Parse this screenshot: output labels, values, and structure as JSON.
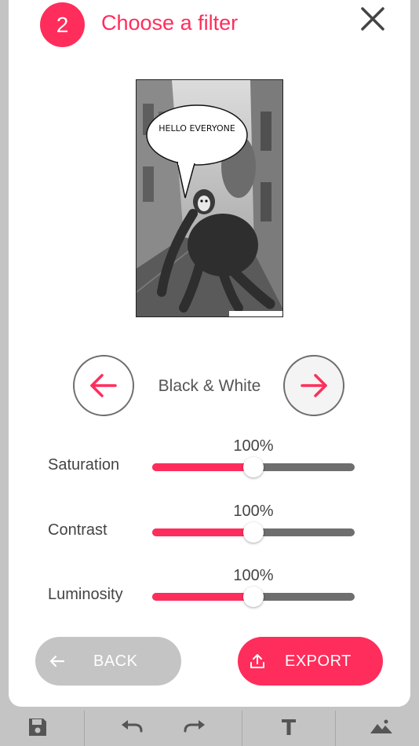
{
  "step": {
    "number": "2",
    "title": "Choose a filter"
  },
  "icons": {
    "close": "close-icon",
    "prev": "arrow-left-icon",
    "next": "arrow-right-icon",
    "back": "arrow-left-icon",
    "export": "upload-icon",
    "save": "save-icon",
    "undo": "undo-icon",
    "redo": "redo-icon",
    "text": "text-icon",
    "image": "image-icon"
  },
  "photo": {
    "speech_bubble": "HELLO EVERYONE"
  },
  "filter": {
    "name": "Black & White"
  },
  "sliders": [
    {
      "label": "Saturation",
      "value_text": "100%",
      "level": 0.5
    },
    {
      "label": "Contrast",
      "value_text": "100%",
      "level": 0.5
    },
    {
      "label": "Luminosity",
      "value_text": "100%",
      "level": 0.5
    }
  ],
  "buttons": {
    "back": "BACK",
    "export": "EXPORT"
  },
  "colors": {
    "accent": "#ff2d5b",
    "background": "#c4c4c4",
    "disabled": "#c4c4c4",
    "track": "#6e6e6e"
  }
}
